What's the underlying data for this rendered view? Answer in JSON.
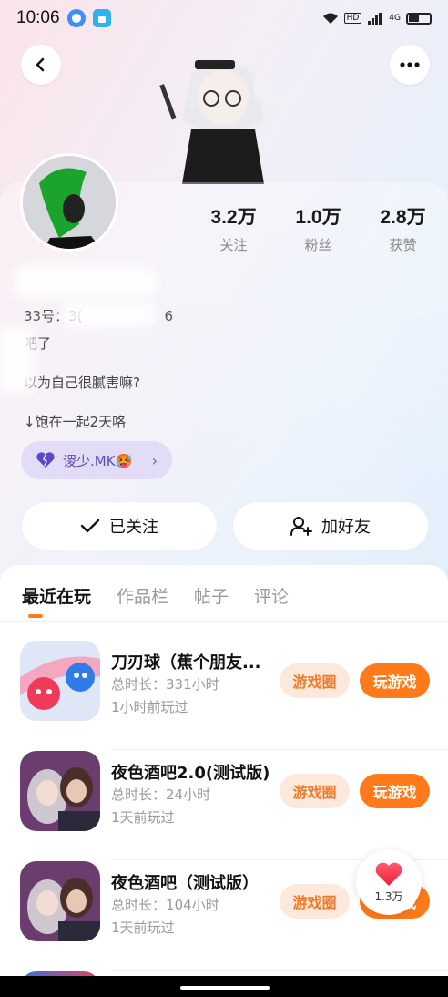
{
  "status_bar": {
    "time": "10:06",
    "network": "4G",
    "hd": "HD"
  },
  "header": {
    "back_icon": "chevron-left-icon",
    "more_icon": "more-dots-icon"
  },
  "profile": {
    "stats": [
      {
        "value": "3.2万",
        "label": "关注"
      },
      {
        "value": "1.0万",
        "label": "粉丝"
      },
      {
        "value": "2.8万",
        "label": "获赞"
      }
    ],
    "id_prefix": "33号：3(",
    "id_suffix": "6",
    "bio_line1": "吧了",
    "bio_line2": "以为自己很腻害嘛?",
    "bio_line3": "↓饱在一起2天咯",
    "guard_label": "谡少.MK🥵"
  },
  "actions": {
    "followed_label": "已关注",
    "add_friend_label": "加好友"
  },
  "tabs": [
    {
      "label": "最近在玩",
      "active": true
    },
    {
      "label": "作品栏",
      "active": false
    },
    {
      "label": "帖子",
      "active": false
    },
    {
      "label": "评论",
      "active": false
    }
  ],
  "games": [
    {
      "title": "刀刃球（蕉个朋友...",
      "duration": "总时长：331小时",
      "last_played": "1小时前玩过",
      "circle_label": "游戏圈",
      "play_label": "玩游戏"
    },
    {
      "title": "夜色酒吧2.0(测试版)",
      "duration": "总时长：24小时",
      "last_played": "1天前玩过",
      "circle_label": "游戏圈",
      "play_label": "玩游戏"
    },
    {
      "title": "夜色酒吧（测试版）",
      "duration": "总时长：104小时",
      "last_played": "1天前玩过",
      "circle_label": "游戏圈",
      "play_label": "玩游戏"
    }
  ],
  "like_float": {
    "count": "1.3万"
  },
  "colors": {
    "accent": "#ff7a1a",
    "accent_light": "#fde9dc",
    "guard_bg": "#e2dcf6"
  }
}
